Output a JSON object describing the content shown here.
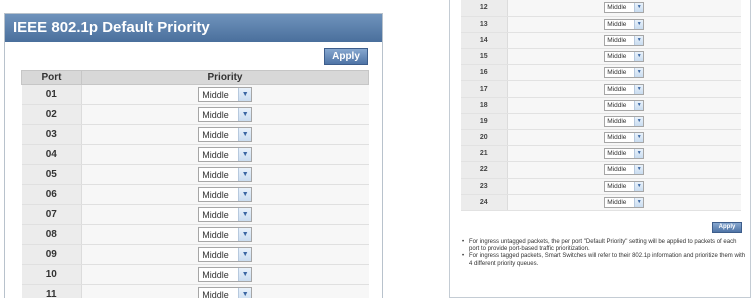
{
  "left_panel": {
    "title": "IEEE 802.1p Default Priority",
    "apply_label": "Apply",
    "columns": {
      "port": "Port",
      "priority": "Priority"
    },
    "rows": [
      {
        "port": "01",
        "priority": "Middle"
      },
      {
        "port": "02",
        "priority": "Middle"
      },
      {
        "port": "03",
        "priority": "Middle"
      },
      {
        "port": "04",
        "priority": "Middle"
      },
      {
        "port": "05",
        "priority": "Middle"
      },
      {
        "port": "06",
        "priority": "Middle"
      },
      {
        "port": "07",
        "priority": "Middle"
      },
      {
        "port": "08",
        "priority": "Middle"
      },
      {
        "port": "09",
        "priority": "Middle"
      },
      {
        "port": "10",
        "priority": "Middle"
      },
      {
        "port": "11",
        "priority": "Middle"
      }
    ]
  },
  "right_panel": {
    "rows": [
      {
        "port": "12",
        "priority": "Middle"
      },
      {
        "port": "13",
        "priority": "Middle"
      },
      {
        "port": "14",
        "priority": "Middle"
      },
      {
        "port": "15",
        "priority": "Middle"
      },
      {
        "port": "16",
        "priority": "Middle"
      },
      {
        "port": "17",
        "priority": "Middle"
      },
      {
        "port": "18",
        "priority": "Middle"
      },
      {
        "port": "19",
        "priority": "Middle"
      },
      {
        "port": "20",
        "priority": "Middle"
      },
      {
        "port": "21",
        "priority": "Middle"
      },
      {
        "port": "22",
        "priority": "Middle"
      },
      {
        "port": "23",
        "priority": "Middle"
      },
      {
        "port": "24",
        "priority": "Middle"
      }
    ],
    "apply_label": "Apply",
    "notes": [
      "For ingress untagged packets, the per port \"Default Priority\" setting will be applied to packets of each port to provide port-based traffic prioritization.",
      "For ingress tagged packets, Smart Switches will refer to their 802.1p information and prioritize them with 4 different priority queues."
    ]
  },
  "icons": {
    "dropdown_arrow": "chevron-down-icon",
    "bullet": "bullet-icon"
  },
  "colors": {
    "title_bar": "#5a80ad",
    "apply_button": "#4f74a6",
    "header_row": "#d8d8d8"
  }
}
